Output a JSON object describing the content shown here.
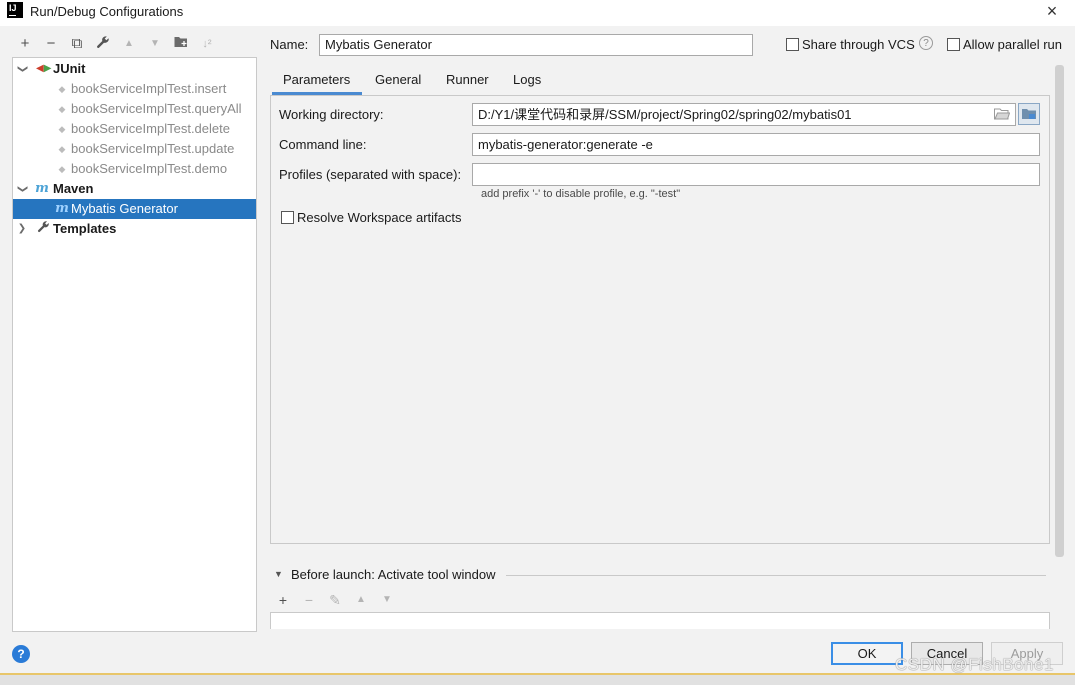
{
  "window": {
    "title": "Run/Debug Configurations",
    "app_logo_text": "IJ",
    "close_icon": "close-icon"
  },
  "toolbar": {
    "icons": [
      "add-icon",
      "remove-icon",
      "copy-icon",
      "wrench-icon",
      "move-up-icon",
      "move-down-icon",
      "new-folder-icon",
      "sort-icon"
    ],
    "add": "+",
    "remove": "−",
    "copy": "⧉",
    "edit": "🔧",
    "up": "▲",
    "down": "▼",
    "folder": "▆",
    "sort": "↓²"
  },
  "tree": {
    "junit": {
      "label": "JUnit",
      "children": [
        "bookServiceImplTest.insert",
        "bookServiceImplTest.queryAll",
        "bookServiceImplTest.delete",
        "bookServiceImplTest.update",
        "bookServiceImplTest.demo"
      ]
    },
    "maven": {
      "label": "Maven",
      "children": [
        "Mybatis Generator"
      ]
    },
    "templates": {
      "label": "Templates"
    }
  },
  "header": {
    "name_label": "Name:",
    "name_value": "Mybatis Generator",
    "share_label": "Share through VCS",
    "share_checked": false,
    "parallel_label": "Allow parallel run",
    "parallel_checked": false
  },
  "tabs": [
    "Parameters",
    "General",
    "Runner",
    "Logs"
  ],
  "active_tab": "Parameters",
  "parameters": {
    "working_dir_label": "Working directory:",
    "working_dir_value": "D:/Y1/课堂代码和录屏/SSM/project/Spring02/spring02/mybatis01",
    "command_line_label": "Command line:",
    "command_line_value": "mybatis-generator:generate -e",
    "profiles_label": "Profiles (separated with space):",
    "profiles_value": "",
    "profiles_hint": "add prefix '-' to disable profile, e.g. \"-test\"",
    "resolve_label": "Resolve Workspace artifacts",
    "resolve_checked": false
  },
  "before_launch": {
    "label": "Before launch: Activate tool window",
    "tools": [
      "+",
      "−",
      "✎",
      "▲",
      "▼"
    ]
  },
  "footer": {
    "ok": "OK",
    "cancel": "Cancel",
    "apply": "Apply",
    "help": "?"
  },
  "watermark": "CSDN @FishBone1",
  "colors": {
    "selection": "#2675bf",
    "accent": "#4a8ad1",
    "help": "#2a7bd7"
  }
}
